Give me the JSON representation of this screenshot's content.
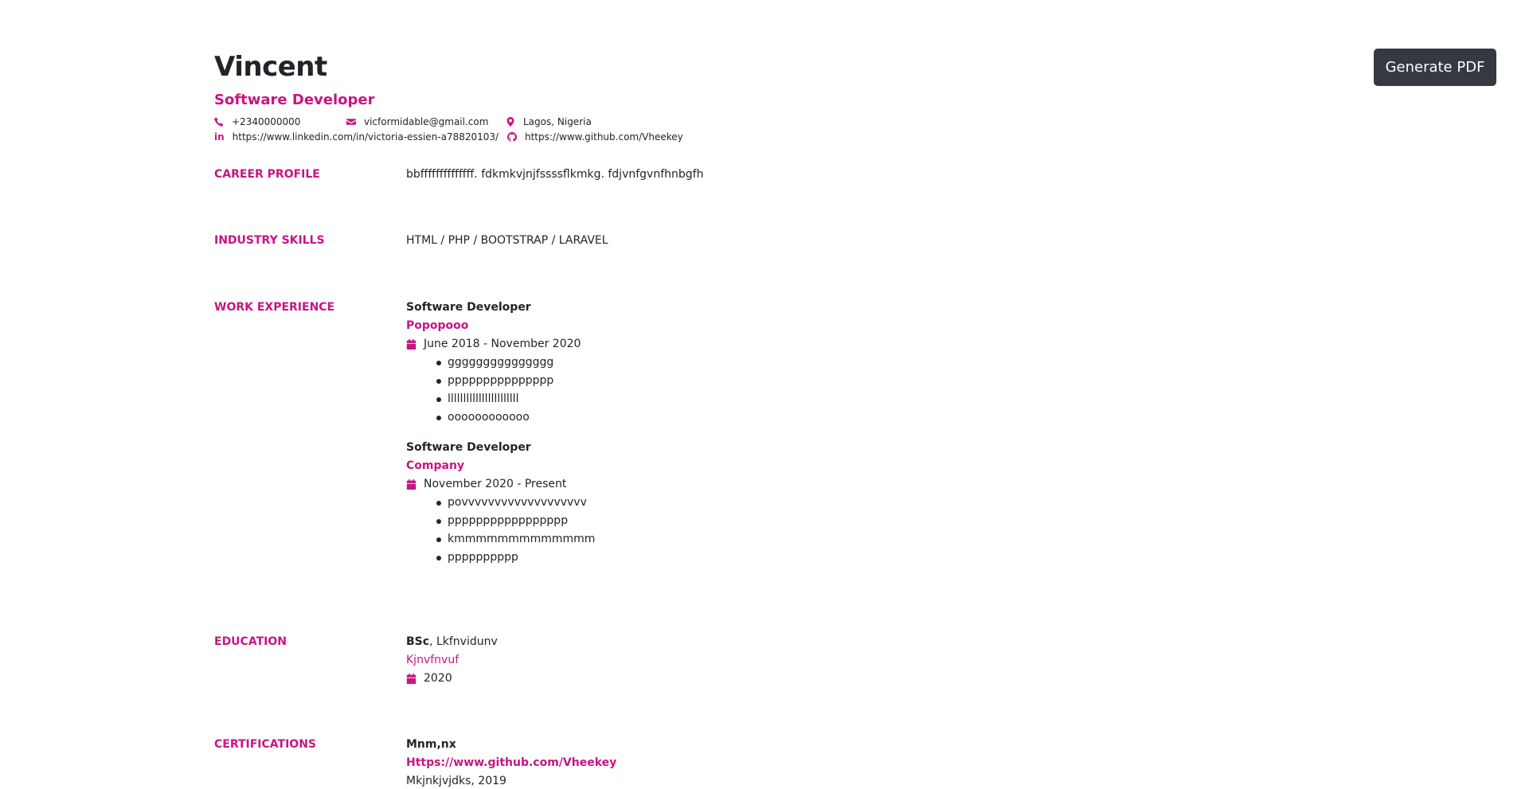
{
  "toolbar": {
    "generate_pdf_label": "Generate PDF"
  },
  "header": {
    "name": "Vincent",
    "title": "Software Developer",
    "phone": "+2340000000",
    "email": "vicformidable@gmail.com",
    "location": "Lagos, Nigeria",
    "linkedin": "https://www.linkedin.com/in/victoria-essien-a78820103/",
    "github": "https://www.github.com/Vheekey"
  },
  "sections": {
    "career_profile": {
      "label": "CAREER PROFILE",
      "text": "bbffffffffffffff. fdkmkvjnjfssssflkmkg. fdjvnfgvnfhnbgfh"
    },
    "industry_skills": {
      "label": "INDUSTRY SKILLS",
      "text": "HTML / PHP / BOOTSTRAP / LARAVEL"
    },
    "work_experience": {
      "label": "WORK EXPERIENCE",
      "jobs": [
        {
          "title": "Software Developer",
          "company": "Popopooo",
          "dates": "June 2018 - November 2020",
          "bullets": [
            "ggggggggggggggg",
            "ppppppppppppppp",
            "lllllllllllllllllllllll",
            "oooooooooooo"
          ]
        },
        {
          "title": "Software Developer",
          "company": "Company",
          "dates": "November 2020 - Present",
          "bullets": [
            "povvvvvvvvvvvvvvvvvvv",
            "ppppppppppppppppp",
            "kmmmmmmmmmmmmm",
            "pppppppppp"
          ]
        }
      ]
    },
    "education": {
      "label": "EDUCATION",
      "degree": "BSc",
      "field": ", Lkfnvidunv",
      "school": "Kjnvfnvuf",
      "year": "2020"
    },
    "certifications": {
      "label": "CERTIFICATIONS",
      "name": "Mnm,nx",
      "link": "Https://www.github.com/Vheekey",
      "issuer_year": "Mkjnkjvjdks, 2019"
    }
  },
  "colors": {
    "accent": "#c71585",
    "text": "#212529",
    "button_bg": "#343a40"
  },
  "icons": [
    "phone-icon",
    "envelope-icon",
    "map-marker-icon",
    "linkedin-icon",
    "github-icon",
    "calendar-icon"
  ]
}
